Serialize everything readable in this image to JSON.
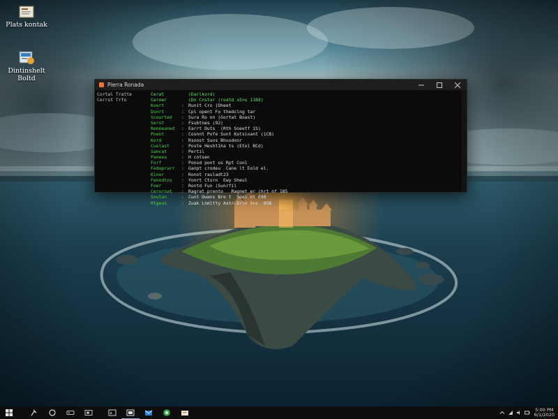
{
  "desktop": {
    "icons": [
      {
        "label": "Plats kontak",
        "icon": "folder-document-icon"
      },
      {
        "label": "Dintinshelt Boltd",
        "icon": "application-shortcut-icon"
      }
    ]
  },
  "terminal": {
    "title": "Pierra Ronada",
    "left_column": [
      "Cortal Tratte",
      "Cerrst Trfo"
    ],
    "rows": [
      {
        "key": "Cerat",
        "sep": "",
        "value": "(Darlkord)"
      },
      {
        "key": "Ceroer",
        "sep": "",
        "value": "(Dn Cnstar (rodtd sEns 1388)"
      },
      {
        "key": "Koert",
        "sep": ":",
        "value": "Runit Cro (Dheet"
      },
      {
        "key": "Donrt",
        "sep": ":",
        "value": "Cpl opent Fo thedclng tar"
      },
      {
        "key": "Scourted",
        "sep": ":",
        "value": "Sura Ro nn (Gortat Boast)"
      },
      {
        "key": "Serst",
        "sep": ":",
        "value": "Fsubtnes (92)"
      },
      {
        "key": "Renneaned",
        "sep": ":",
        "value": "Earrt Duts  (Rth Sneetf 1S)"
      },
      {
        "key": "Poent",
        "sep": ":",
        "value": "Cosnnt Pofe Sunt Kotsioant (1CB)"
      },
      {
        "key": "Kord",
        "sep": ":",
        "value": "Rsoost Suns Bhusdonr"
      },
      {
        "key": "Cuelast",
        "sep": ":",
        "value": "Poste Heshtiha ts (Etol RCd)"
      },
      {
        "key": "Sancat",
        "sep": ":",
        "value": "Pertil"
      },
      {
        "key": "Panees",
        "sep": ":",
        "value": "H cotsen"
      },
      {
        "key": "Forf",
        "sep": ":",
        "value": "Ponsd pont os Rpt Conl"
      },
      {
        "key": "Fedoprarr",
        "sep": ":",
        "value": "Ganpt crodeu  Cane lt Eold el."
      },
      {
        "key": "Kinor",
        "sep": ":",
        "value": "Ronot rauladt23"
      },
      {
        "key": "Fenodtos",
        "sep": ":",
        "value": "Yonrt Ctsrn  Ewy Sheul"
      },
      {
        "key": "Foer",
        "sep": ":",
        "value": "Rontd Fun (Sunrfil"
      },
      {
        "key": "Cernrnat",
        "sep": ":",
        "value": "Ragrat prento   Ragnet er (hrt nf 185"
      },
      {
        "key": "Soutan",
        "sep": ":",
        "value": "Cunt Dwans Bre t  Soel nt E80"
      },
      {
        "key": "Rtgeus",
        "sep": ":",
        "value": "Zuak Lnmltty Aatr Drln Sns  85B"
      }
    ]
  },
  "taskbar": {
    "buttons": [
      {
        "name": "start-button",
        "icon": "windows-logo-icon"
      },
      {
        "name": "search-button",
        "icon": "search-icon"
      },
      {
        "name": "cortana-button",
        "icon": "circle-icon"
      },
      {
        "name": "game-bar-button",
        "icon": "gamepad-icon"
      },
      {
        "name": "task-view-button",
        "icon": "task-view-icon"
      },
      {
        "name": "pinned-terminal-button",
        "icon": "terminal-icon"
      },
      {
        "name": "pinned-window-button",
        "icon": "window-icon"
      },
      {
        "name": "pinned-mail-button",
        "icon": "mail-icon"
      },
      {
        "name": "pinned-browser-button",
        "icon": "browser-icon"
      },
      {
        "name": "pinned-explorer-button",
        "icon": "folder-icon"
      }
    ],
    "clock": {
      "time": "5:00 PM",
      "date": "6/1/2020"
    }
  },
  "colors": {
    "terminal_green": "#5ec55e",
    "terminal_bg": "#0b0b0b",
    "taskbar_bg": "#0d0d0f"
  }
}
